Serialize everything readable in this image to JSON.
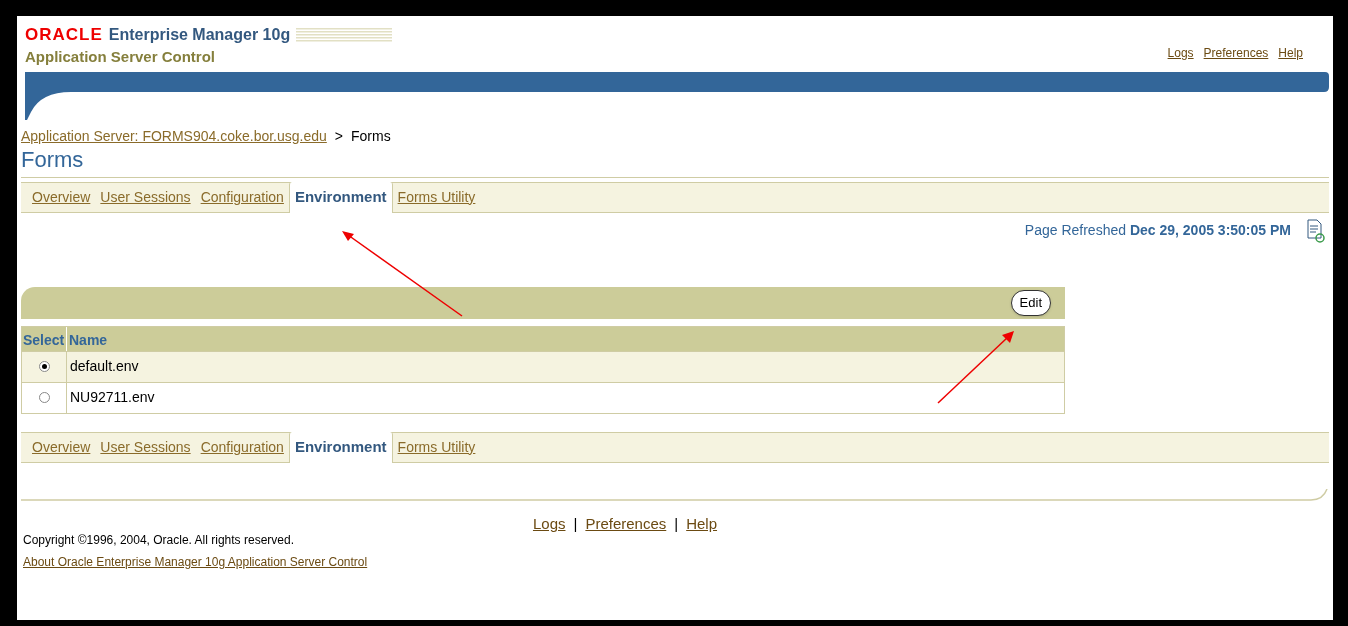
{
  "header": {
    "logo": "ORACLE",
    "product": "Enterprise Manager 10g",
    "subtitle": "Application Server Control"
  },
  "global_links": [
    "Logs",
    "Preferences",
    "Help"
  ],
  "breadcrumb": {
    "link": "Application Server: FORMS904.coke.bor.usg.edu",
    "separator": ">",
    "current": "Forms"
  },
  "page_title": "Forms",
  "tabs": [
    {
      "label": "Overview",
      "selected": false
    },
    {
      "label": "User Sessions",
      "selected": false
    },
    {
      "label": "Configuration",
      "selected": false
    },
    {
      "label": "Environment",
      "selected": true
    },
    {
      "label": "Forms Utility",
      "selected": false
    }
  ],
  "refresh": {
    "label": "Page Refreshed",
    "value": "Dec 29, 2005 3:50:05 PM"
  },
  "table": {
    "action": "Edit",
    "columns": [
      "Select",
      "Name"
    ],
    "rows": [
      {
        "name": "default.env",
        "selected": true
      },
      {
        "name": "NU92711.env",
        "selected": false
      }
    ]
  },
  "bottom_tabs": [
    {
      "label": "Overview",
      "selected": false
    },
    {
      "label": "User Sessions",
      "selected": false
    },
    {
      "label": "Configuration",
      "selected": false
    },
    {
      "label": "Environment",
      "selected": true
    },
    {
      "label": "Forms Utility",
      "selected": false
    }
  ],
  "footer_links": [
    "Logs",
    "Preferences",
    "Help"
  ],
  "footer_separator": "|",
  "copyright": "Copyright ©1996, 2004, Oracle. All rights reserved.",
  "about_link": "About Oracle Enterprise Manager 10g Application Server Control"
}
